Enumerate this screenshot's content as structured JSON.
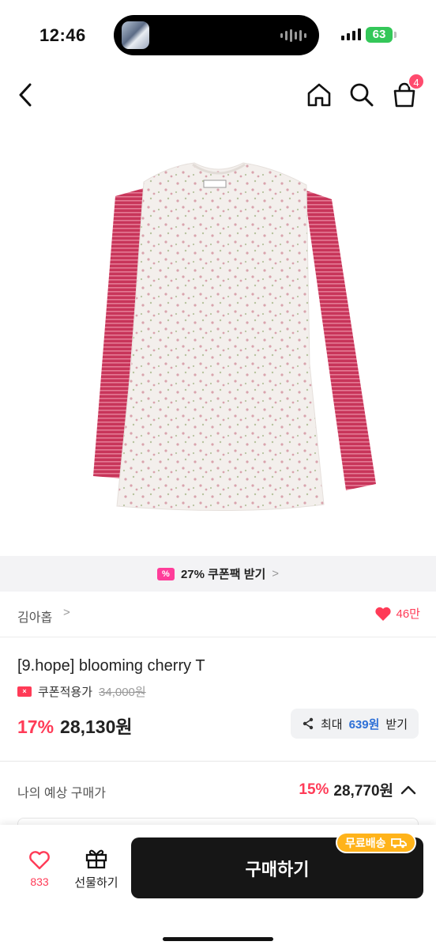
{
  "status_bar": {
    "time": "12:46",
    "battery": "63"
  },
  "nav": {
    "cart_count": "4"
  },
  "product_image": {
    "colors": {
      "body": "#f3efec",
      "sleeve": "#c8355a",
      "stripe": "#e47a94",
      "flower": "#d9a3ad"
    }
  },
  "coupon_bar": {
    "icon_text": "%",
    "text": "27% 쿠폰팩 받기",
    "arrow": ">"
  },
  "store": {
    "name": "김아홉",
    "arrow": ">",
    "likes": "46만"
  },
  "product": {
    "title": "[9.hope] blooming cherry T",
    "coupon_applied_label": "쿠폰적용가",
    "original_price": "34,000원",
    "discount": "17%",
    "price": "28,130원"
  },
  "reward": {
    "prefix": "최대",
    "amount": "639원",
    "suffix": "받기"
  },
  "estimate": {
    "label": "나의 예상 구매가",
    "discount": "15%",
    "price": "28,770원"
  },
  "bottom_bar": {
    "like_count": "833",
    "gift_label": "선물하기",
    "buy_label": "구매하기",
    "shipping_badge": "무료배송"
  },
  "colors": {
    "accent": "#ff3b57",
    "coupon_pink": "#ff3d9a",
    "reward_blue": "#2d6fd6",
    "ship_orange": "#ffb31a"
  }
}
